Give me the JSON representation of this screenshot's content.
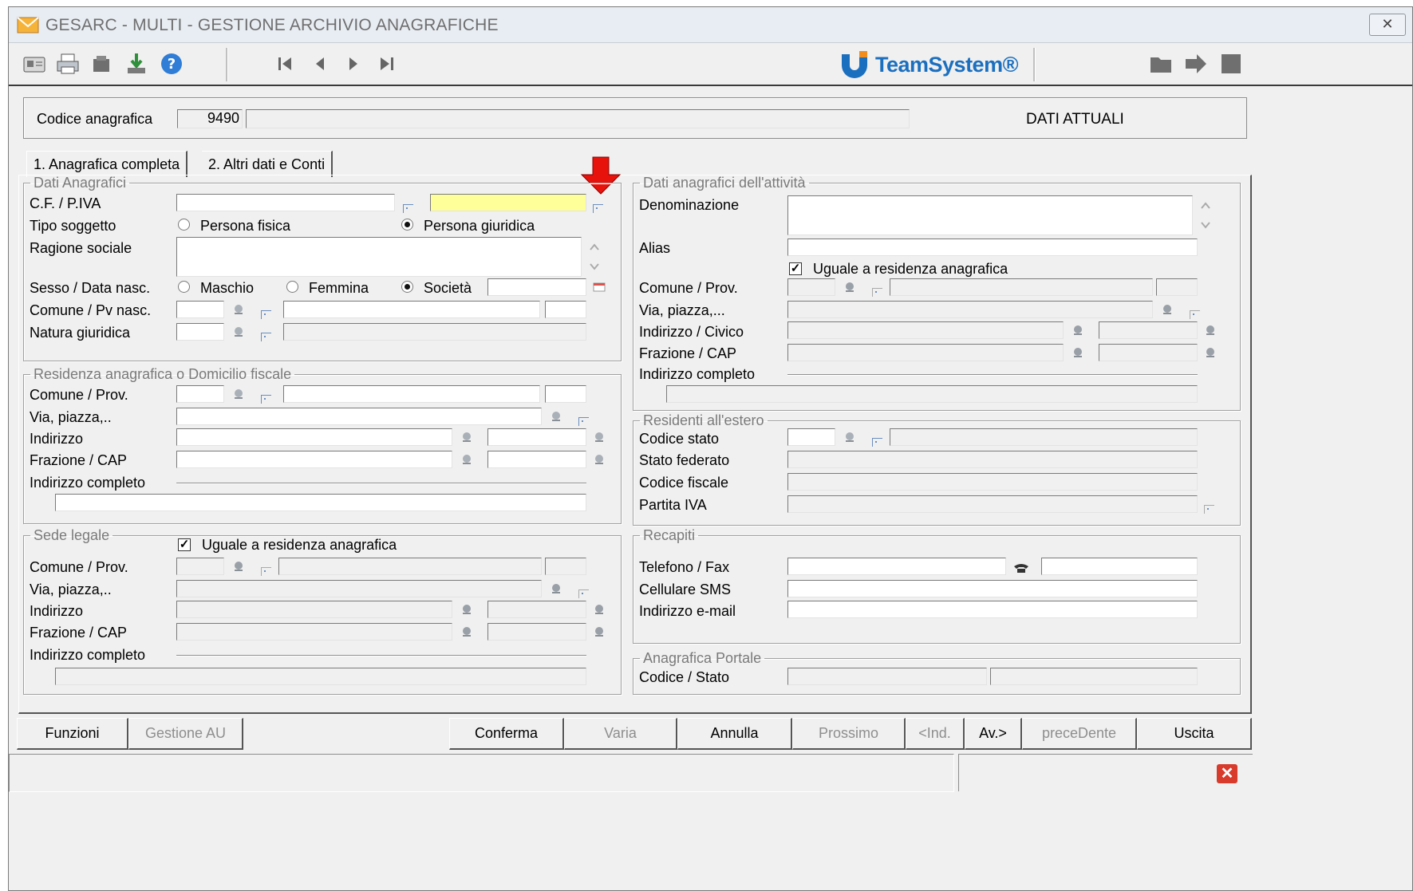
{
  "window": {
    "title": "GESARC  - MULTI -  GESTIONE ARCHIVIO ANAGRAFICHE",
    "close_icon": "close-icon",
    "brand": "TeamSystem®"
  },
  "toolbar": {
    "icons": [
      "card-icon",
      "print-icon",
      "stamp-icon",
      "download-icon",
      "help-icon"
    ],
    "nav_icons": [
      "first-record-icon",
      "previous-icon",
      "next-icon",
      "last-record-icon"
    ],
    "right_icons": [
      "folder-icon",
      "arrow-right-icon",
      "document-icon"
    ]
  },
  "header": {
    "codice_label": "Codice anagrafica",
    "codice_value": "9490",
    "description_value": "",
    "status_text": "DATI ATTUALI"
  },
  "tabs": [
    {
      "label": "1. Anagrafica completa",
      "active": true
    },
    {
      "label": "2. Altri dati e Conti",
      "active": false
    }
  ],
  "dati_anagrafici": {
    "legend": "Dati Anagrafici",
    "cf_piva_label": "C.F. / P.IVA",
    "tipo_soggetto_label": "Tipo soggetto",
    "tipo_options": [
      "Persona fisica",
      "Persona giuridica"
    ],
    "tipo_selected": "Persona giuridica",
    "ragione_sociale_label": "Ragione sociale",
    "sesso_label": "Sesso / Data nasc.",
    "sesso_options": [
      "Maschio",
      "Femmina",
      "Società"
    ],
    "sesso_selected": "Società",
    "comune_pv_nasc_label": "Comune / Pv nasc.",
    "natura_giuridica_label": "Natura giuridica"
  },
  "residenza": {
    "legend": "Residenza anagrafica o Domicilio fiscale",
    "comune_label": "Comune / Prov.",
    "via_label": "Via, piazza,..",
    "indirizzo_label": "Indirizzo",
    "frazione_label": "Frazione / CAP",
    "completo_label": "Indirizzo completo"
  },
  "sede_legale": {
    "legend": "Sede legale",
    "uguale_label": "Uguale a residenza anagrafica",
    "uguale_checked": true,
    "comune_label": "Comune / Prov.",
    "via_label": "Via, piazza,..",
    "indirizzo_label": "Indirizzo",
    "frazione_label": "Frazione / CAP",
    "completo_label": "Indirizzo completo"
  },
  "attivita": {
    "legend": "Dati anagrafici dell'attività",
    "denominazione_label": "Denominazione",
    "alias_label": "Alias",
    "uguale_label": "Uguale a residenza anagrafica",
    "uguale_checked": true,
    "comune_label": "Comune / Prov.",
    "via_label": "Via, piazza,...",
    "indirizzo_label": "Indirizzo / Civico",
    "frazione_label": "Frazione / CAP",
    "completo_label": "Indirizzo completo"
  },
  "estero": {
    "legend": "Residenti all'estero",
    "codice_stato_label": "Codice stato",
    "stato_federato_label": "Stato federato",
    "codice_fiscale_label": "Codice fiscale",
    "partita_iva_label": "Partita IVA"
  },
  "recapiti": {
    "legend": "Recapiti",
    "telefono_label": "Telefono / Fax",
    "cellulare_label": "Cellulare SMS",
    "email_label": "Indirizzo e-mail"
  },
  "portale": {
    "legend": "Anagrafica Portale",
    "codice_stato_label": "Codice / Stato"
  },
  "buttons": {
    "funzioni": "Funzioni",
    "gestione_au": "Gestione AU",
    "conferma": "Conferma",
    "varia": "Varia",
    "annulla": "Annulla",
    "prossimo": "Prossimo",
    "ind": "<Ind.",
    "av": "Av.>",
    "precedente": "preceDente",
    "uscita": "Uscita"
  },
  "colors": {
    "highlight_field": "#ffff99",
    "annotation_arrow": "#e8120c",
    "brand_blue": "#1b6fbf"
  }
}
